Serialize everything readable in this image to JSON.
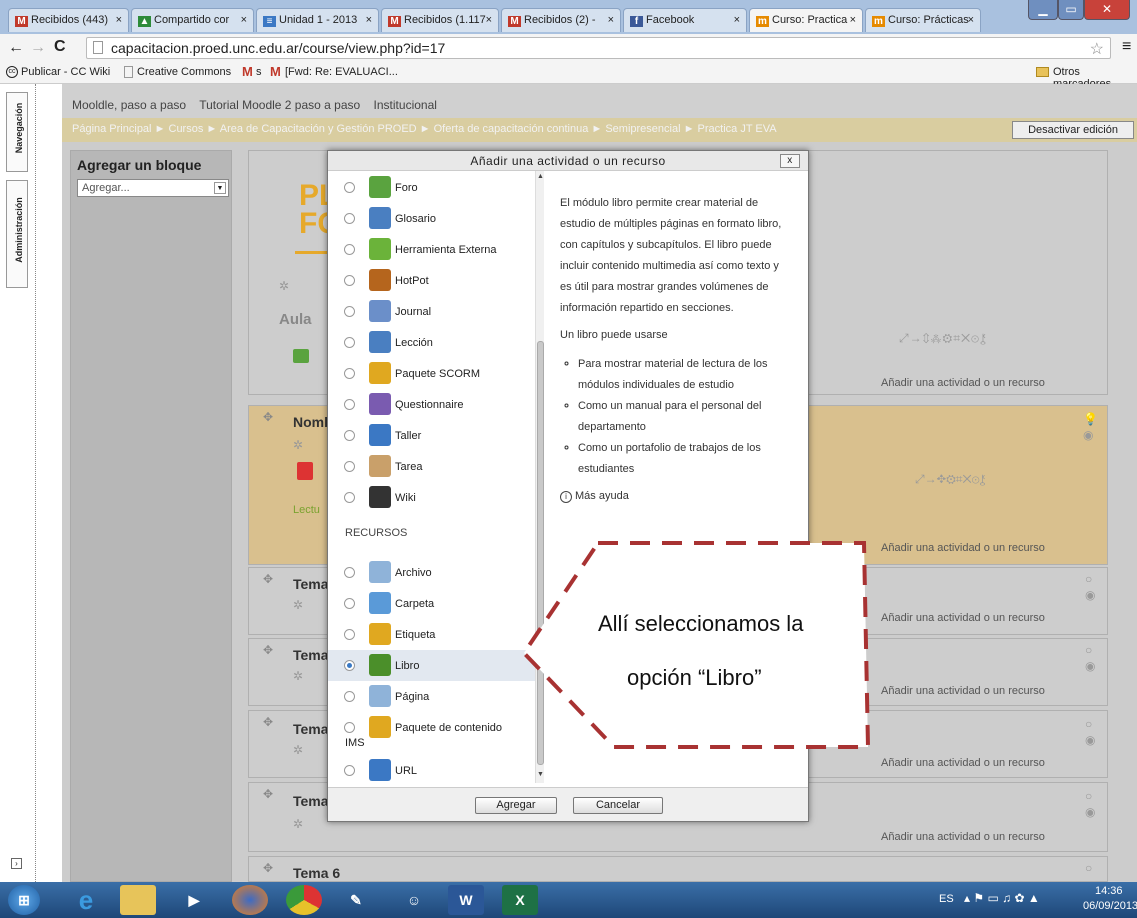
{
  "tabs": [
    {
      "label": "Recibidos (443)",
      "icon": "M",
      "color": "#c0392b",
      "active": false
    },
    {
      "label": "Compartido cor",
      "icon": "▲",
      "color": "#2e8b3a",
      "active": false
    },
    {
      "label": "Unidad 1 - 2013",
      "icon": "≡",
      "color": "#3b78c4",
      "active": false
    },
    {
      "label": "Recibidos (1.117",
      "icon": "M",
      "color": "#c0392b",
      "active": false
    },
    {
      "label": "Recibidos (2) -",
      "icon": "M",
      "color": "#c0392b",
      "active": false
    },
    {
      "label": "Facebook",
      "icon": "f",
      "color": "#3b5998",
      "active": false
    },
    {
      "label": "Curso: Practica",
      "icon": "m",
      "color": "#e68a00",
      "active": true
    },
    {
      "label": "Curso: Prácticas",
      "icon": "m",
      "color": "#e68a00",
      "active": false
    }
  ],
  "address": {
    "url": "capacitacion.proed.unc.edu.ar/course/view.php?id=17"
  },
  "bookmarks": [
    "Publicar - CC Wiki",
    "Creative Commons",
    "s",
    "[Fwd: Re: EVALUACI..."
  ],
  "bookmarks_other": "Otros marcadores",
  "dock": [
    "Navegación",
    "Administración"
  ],
  "navbar": [
    "Mooldle, paso a paso",
    "Tutorial Moodle 2 paso a paso",
    "Institucional"
  ],
  "breadcrumb": [
    "Página Principal",
    "Cursos",
    "Area de Capacitación y Gestión PROED",
    "Oferta de capacitación continua",
    "Semipresencial",
    "Practica JT EVA"
  ],
  "edit_button": "Desactivar edición",
  "block": {
    "title": "Agregar un bloque",
    "select": "Agregar..."
  },
  "sections": [
    {
      "title": "Nomb",
      "visible_label": "Lectu"
    },
    {
      "title": "Tema"
    },
    {
      "title": "Tema"
    },
    {
      "title": "Tema"
    },
    {
      "title": "Tema"
    },
    {
      "title": "Tema 6"
    }
  ],
  "course_fragments": {
    "logo_top": "PL",
    "logo_bottom": "FC",
    "aula": "Aula"
  },
  "add_activity": "Añadir una actividad o un recurso",
  "dialog": {
    "title": "Añadir una actividad o un recurso",
    "close": "x",
    "activities": [
      {
        "label": "Foro",
        "icon": "forum-icon",
        "color": "#5aa33f"
      },
      {
        "label": "Glosario",
        "icon": "glossary-icon",
        "color": "#4a7fc1"
      },
      {
        "label": "Herramienta Externa",
        "icon": "puzzle-icon",
        "color": "#6bb33a"
      },
      {
        "label": "HotPot",
        "icon": "hotpot-icon",
        "color": "#b5651d"
      },
      {
        "label": "Journal",
        "icon": "journal-icon",
        "color": "#6b8fc9"
      },
      {
        "label": "Lección",
        "icon": "lesson-icon",
        "color": "#4a7fc1"
      },
      {
        "label": "Paquete SCORM",
        "icon": "scorm-icon",
        "color": "#e0a820"
      },
      {
        "label": "Questionnaire",
        "icon": "questionnaire-icon",
        "color": "#7a5bb0"
      },
      {
        "label": "Taller",
        "icon": "workshop-icon",
        "color": "#3b78c4"
      },
      {
        "label": "Tarea",
        "icon": "assignment-icon",
        "color": "#c9a06a"
      },
      {
        "label": "Wiki",
        "icon": "wiki-icon",
        "color": "#333333"
      }
    ],
    "resources_heading": "RECURSOS",
    "resources": [
      {
        "label": "Archivo",
        "icon": "file-icon",
        "color": "#8fb3d9"
      },
      {
        "label": "Carpeta",
        "icon": "folder-icon",
        "color": "#5a9ad8"
      },
      {
        "label": "Etiqueta",
        "icon": "label-icon",
        "color": "#e0a820"
      },
      {
        "label": "Libro",
        "icon": "book-icon",
        "color": "#4b8f2a",
        "selected": true
      },
      {
        "label": "Página",
        "icon": "page-icon",
        "color": "#8fb3d9"
      },
      {
        "label": "Paquete de contenido",
        "icon": "ims-icon",
        "color": "#e0a820"
      },
      {
        "label": "URL",
        "icon": "url-icon",
        "color": "#3b78c4"
      }
    ],
    "ims_suffix": "IMS",
    "help_paragraph": "El módulo libro permite crear material de estudio de múltiples páginas en formato libro, con capítulos y subcapítulos. El libro puede incluir contenido multimedia así como texto y es útil para mostrar grandes volúmenes de información repartido en secciones.",
    "help_uses_title": "Un libro puede usarse",
    "help_uses": [
      "Para mostrar material de lectura de los módulos individuales de estudio",
      "Como un manual para el personal del departamento",
      "Como un portafolio de trabajos de los estudiantes"
    ],
    "more_help": "Más ayuda",
    "add_button": "Agregar",
    "cancel_button": "Cancelar"
  },
  "callout": {
    "line1": "Allí seleccionamos la",
    "line2": "opción “Libro”",
    "border_color": "#a83232"
  },
  "clock": {
    "time": "14:36",
    "date": "06/09/2013",
    "lang": "ES"
  }
}
